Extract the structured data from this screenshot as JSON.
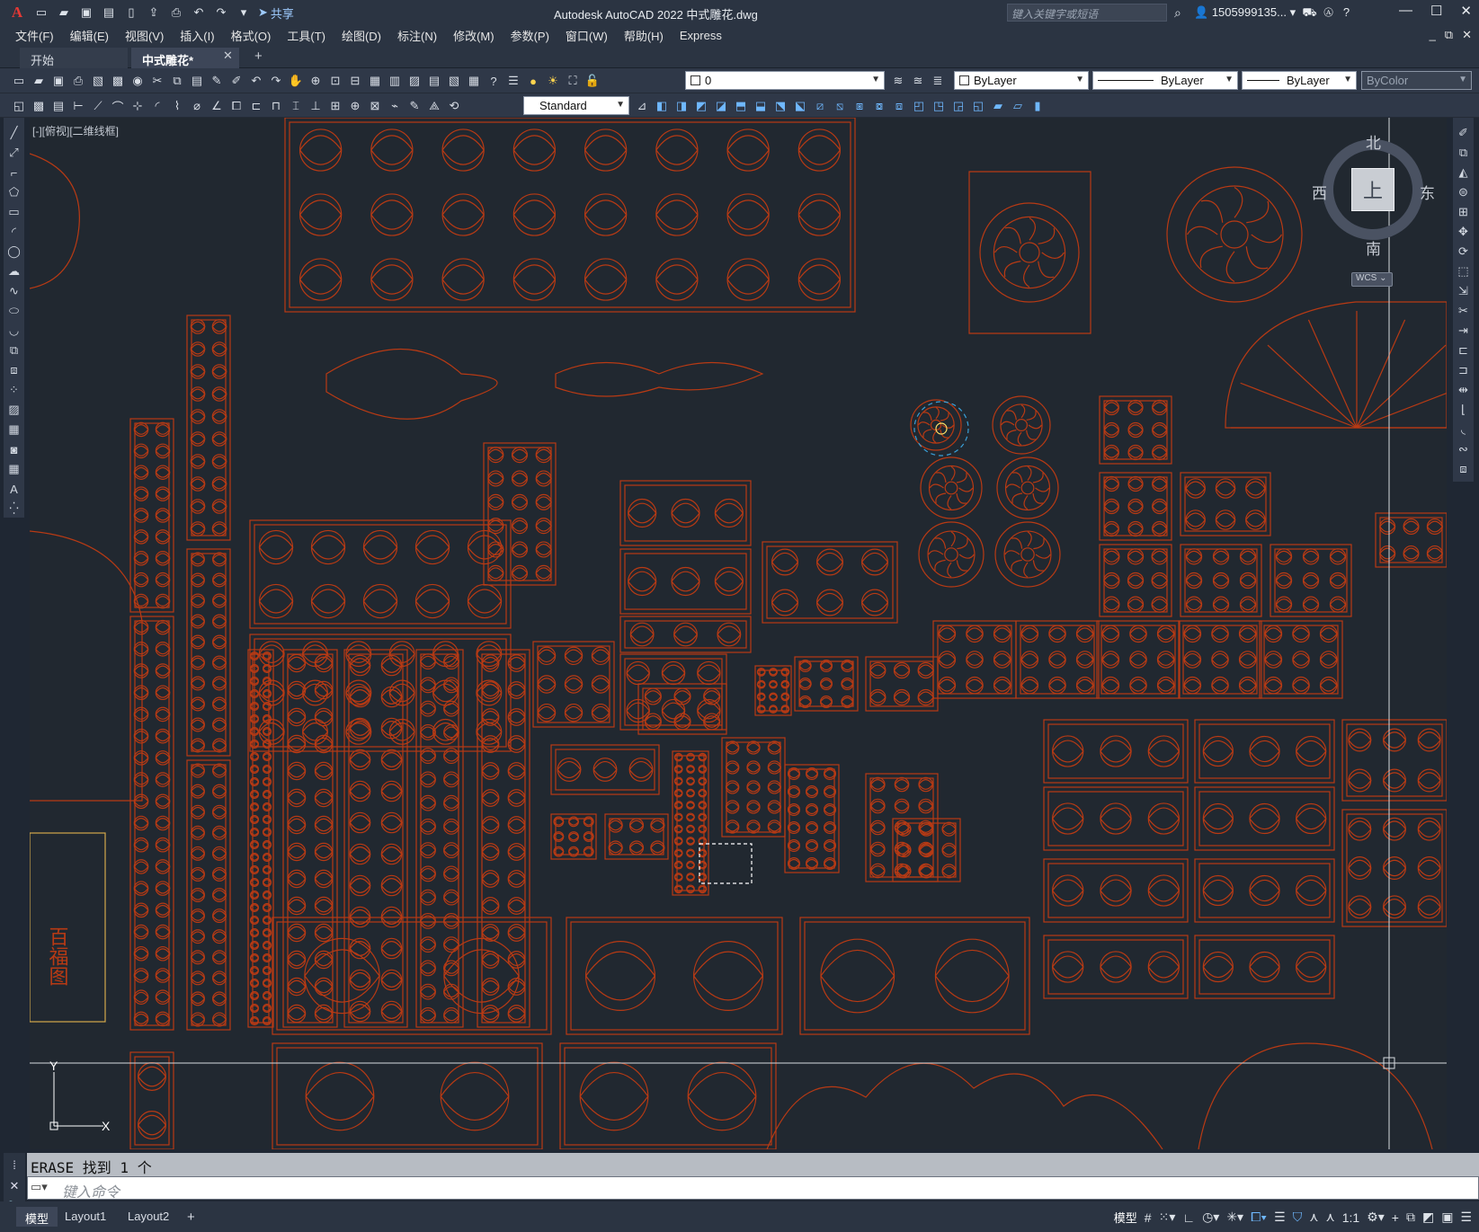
{
  "titlebar": {
    "app_logo": "A",
    "share_label": "共享",
    "title": "Autodesk AutoCAD 2022    中式雕花.dwg",
    "search_placeholder": "键入关键字或短语",
    "user": "1505999135...",
    "icons": [
      "new-icon",
      "open-icon",
      "save-icon",
      "saveas-icon",
      "print-icon",
      "plot-icon",
      "undo-icon",
      "redo-icon",
      "share-icon",
      "search-icon",
      "user-icon",
      "cart-icon",
      "autodesk-icon",
      "help-icon",
      "minimize-icon",
      "maximize-icon",
      "close-icon"
    ]
  },
  "menu": {
    "items": [
      "文件(F)",
      "编辑(E)",
      "视图(V)",
      "插入(I)",
      "格式(O)",
      "工具(T)",
      "绘图(D)",
      "标注(N)",
      "修改(M)",
      "参数(P)",
      "窗口(W)",
      "帮助(H)",
      "Express"
    ]
  },
  "tabs": {
    "start": "开始",
    "drawing": "中式雕花*",
    "close_glyph": "✕",
    "add_glyph": "+"
  },
  "toolbar": {
    "layer_value": "0",
    "color_value": "ByLayer",
    "linetype_value": "ByLayer",
    "lineweight_value": "ByLayer",
    "plotstyle_value": "ByColor",
    "textstyle_value": "Standard"
  },
  "canvas": {
    "view_label": "[-][俯视][二维线框]",
    "drawing_color": "#b83a14",
    "background": "#212830",
    "text_hundred_fortune": "百福图"
  },
  "viewcube": {
    "north": "北",
    "south": "南",
    "east": "东",
    "west": "西",
    "top_face": "上",
    "wcs": "WCS ⌄"
  },
  "ucs": {
    "y_label": "Y",
    "x_label": "X"
  },
  "command": {
    "history": "ERASE 找到 1 个",
    "placeholder": "键入命令"
  },
  "status": {
    "layout_tabs": [
      "模型",
      "Layout1",
      "Layout2"
    ],
    "add_tab": "+",
    "model_button": "模型",
    "scale": "1:1"
  }
}
